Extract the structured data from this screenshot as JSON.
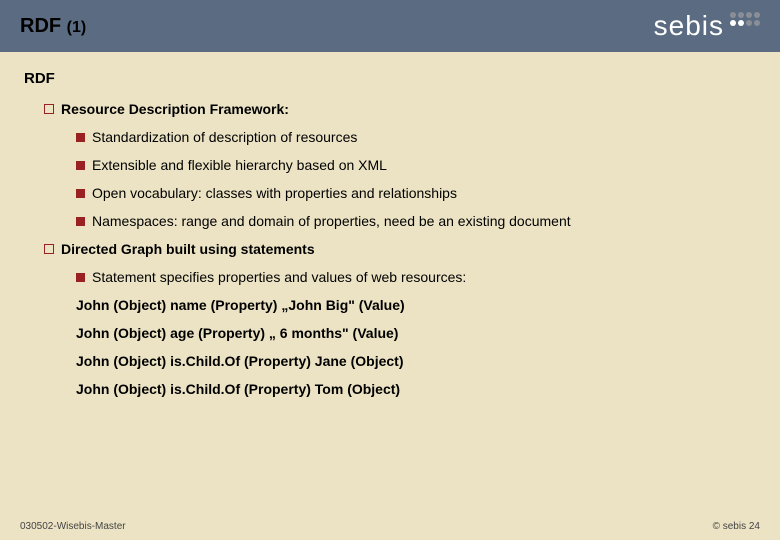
{
  "header": {
    "title_main": "RDF ",
    "title_sub": "(1)",
    "logo_text": "sebis"
  },
  "content": {
    "heading": "RDF",
    "section1": {
      "label": "Resource Description Framework:",
      "items": [
        "Standardization of description of resources",
        "Extensible and flexible hierarchy based on XML",
        "Open vocabulary: classes with properties and relationships",
        "Namespaces: range and domain of properties, need be an existing document"
      ]
    },
    "section2": {
      "label": "Directed Graph built using statements",
      "items": [
        "Statement specifies properties and values of web resources:"
      ],
      "statements": [
        "John (Object) name (Property) „John Big\" (Value)",
        "John (Object) age (Property) „ 6 months\" (Value)",
        "John (Object) is.Child.Of (Property) Jane (Object)",
        "John (Object) is.Child.Of (Property) Tom (Object)"
      ]
    }
  },
  "footer": {
    "left": "030502-Wisebis-Master",
    "right": "© sebis  24"
  }
}
